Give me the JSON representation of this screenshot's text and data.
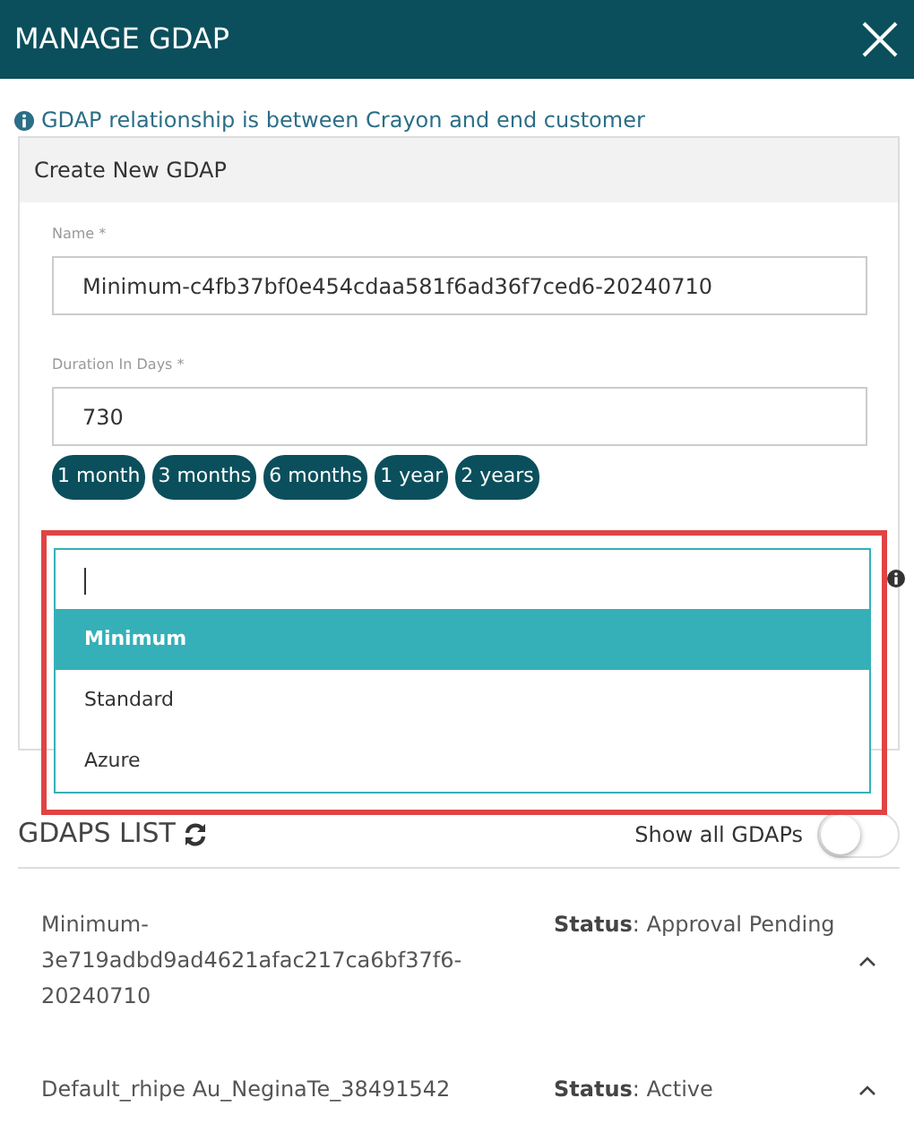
{
  "window": {
    "title": "MANAGE GDAP"
  },
  "info": "GDAP relationship is between Crayon and end customer",
  "panel": {
    "title": "Create New GDAP",
    "fields": [
      {
        "label": "Name *",
        "value": "Minimum-c4fb37bf0e454cdaa581f6ad36f7ced6-20240710"
      },
      {
        "label": "Duration In Days *",
        "value": "730"
      }
    ],
    "chips": [
      "1 month",
      "3 months",
      "6 months",
      "1 year",
      "2 years"
    ],
    "dropdown": {
      "expanded": true,
      "highlighted": true,
      "options": [
        {
          "label": "Minimum",
          "selected": true
        },
        {
          "label": "Standard",
          "selected": false
        },
        {
          "label": "Azure",
          "selected": false
        }
      ]
    }
  },
  "list": {
    "title": "GDAPS LIST",
    "toggle": {
      "label": "Show all GDAPs",
      "on": false
    },
    "rows": [
      {
        "name": "Minimum-\n3e719adbd9ad4621afac217ca6bf37f6-\n20240710",
        "status_label": "Status",
        "status": ": Approval Pending",
        "expanded": true
      },
      {
        "name": "Default_rhipe Au_NeginaTe_38491542",
        "status_label": "Status",
        "status": ": Active",
        "expanded": true
      }
    ]
  }
}
